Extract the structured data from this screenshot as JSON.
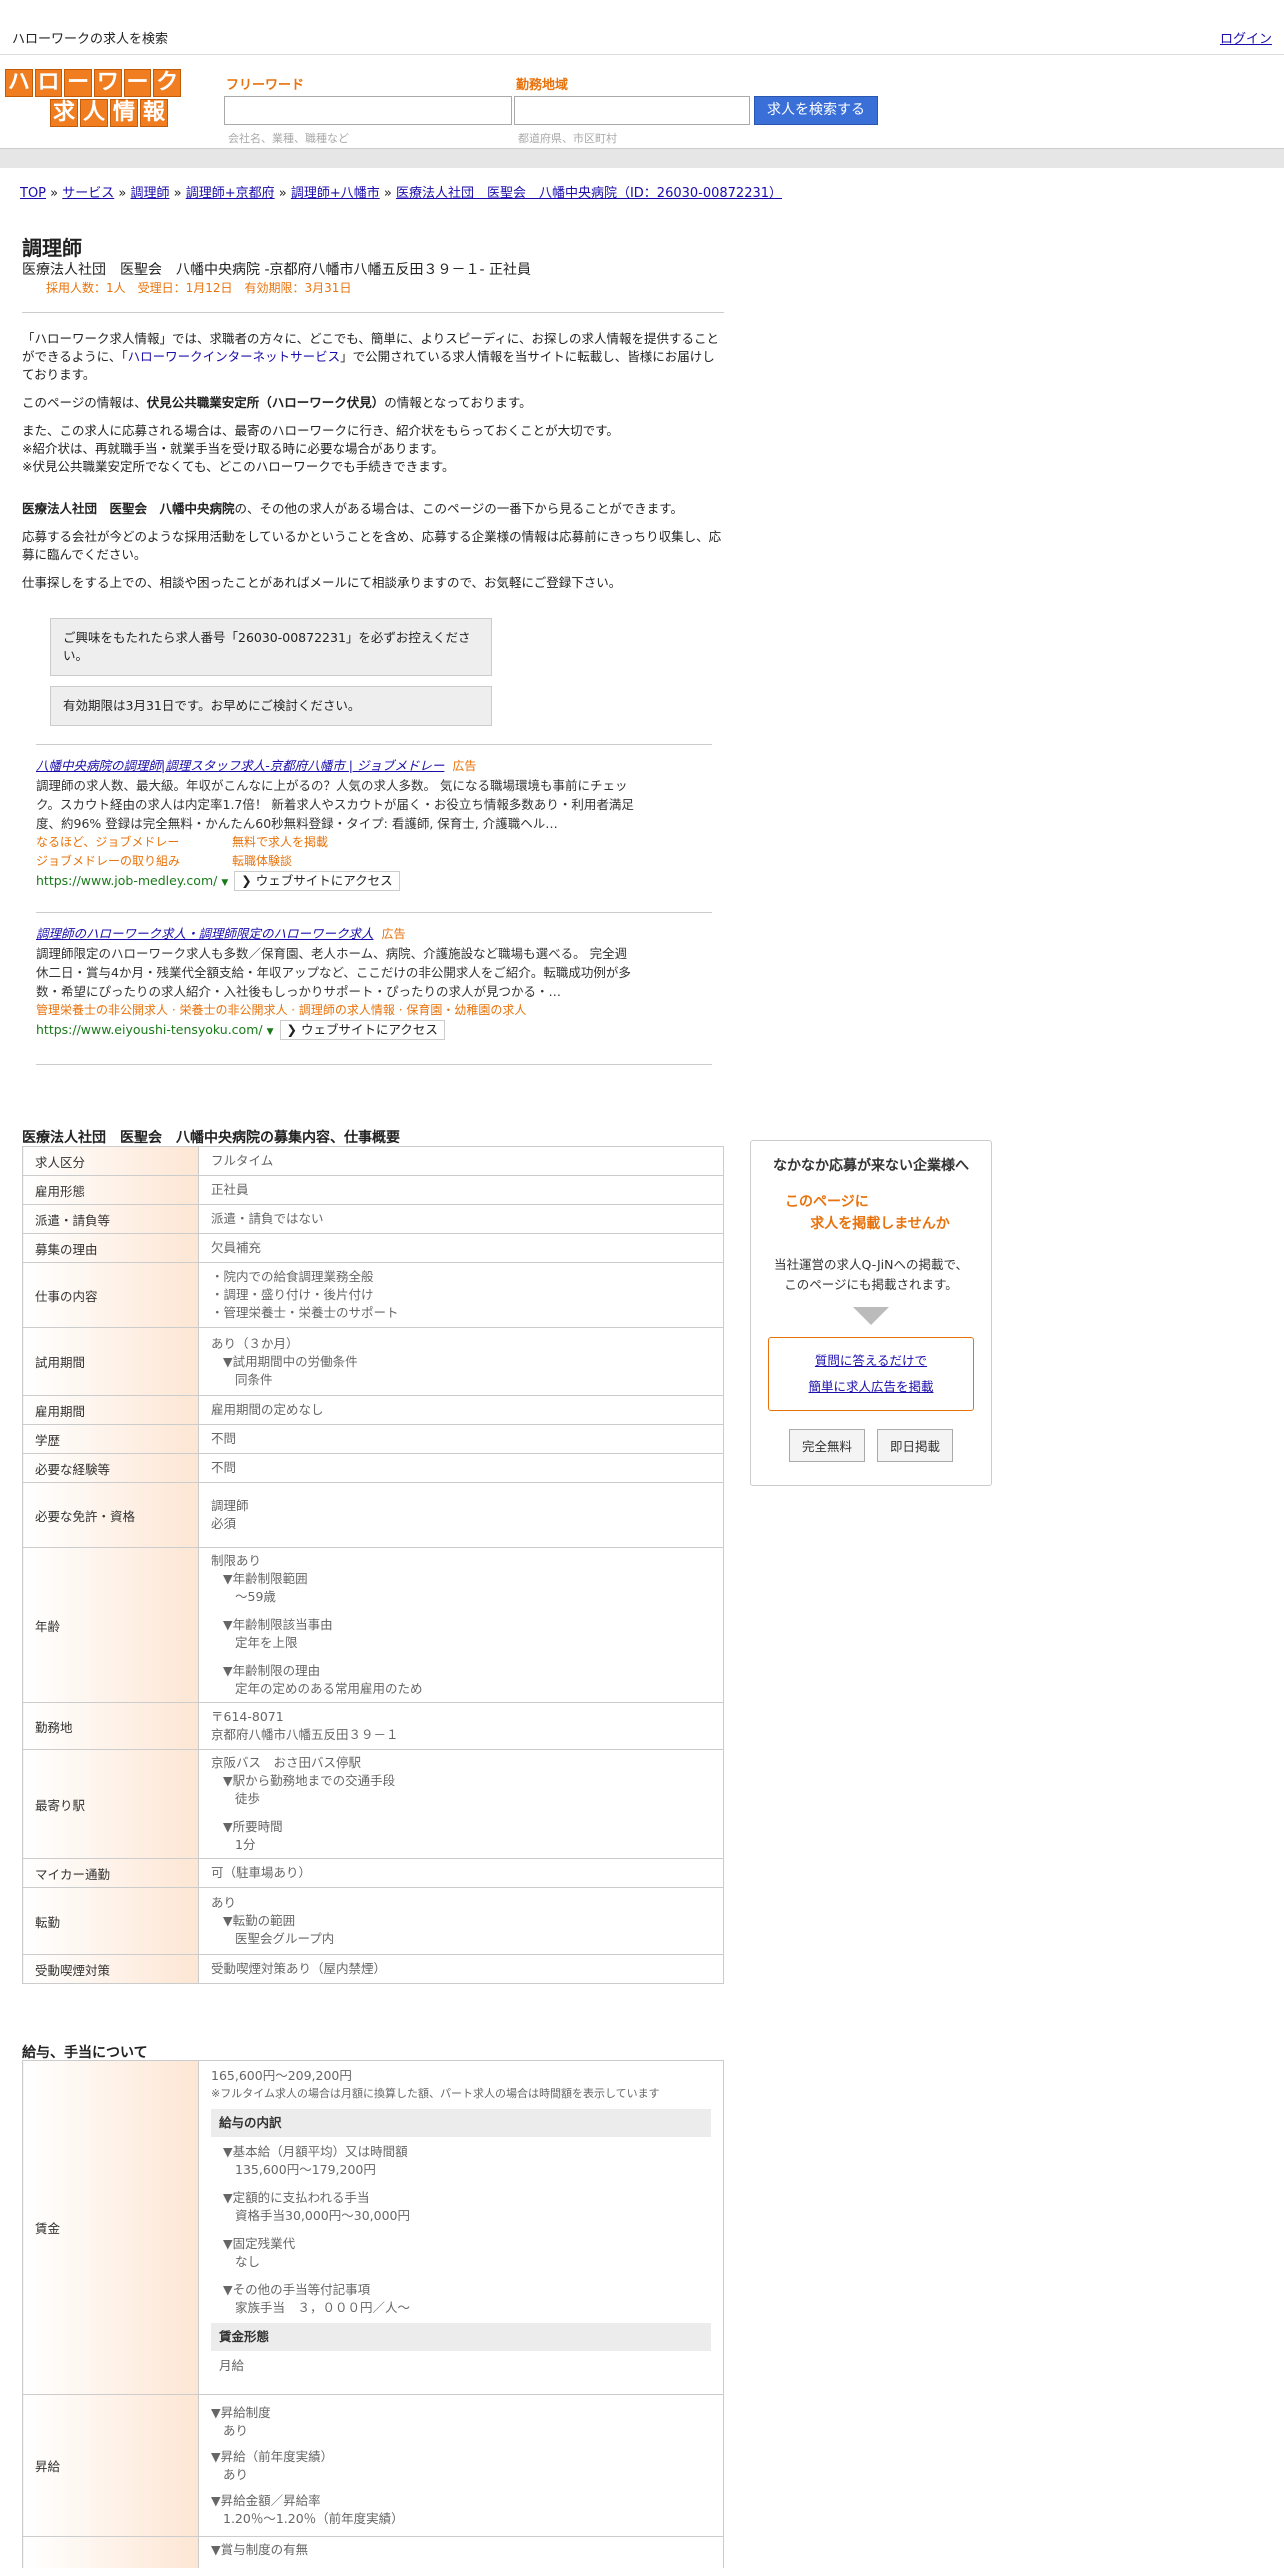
{
  "header": {
    "site_title": "ハローワークの求人を検索",
    "login": "ログイン"
  },
  "logo": {
    "row1": [
      "ハ",
      "ロ",
      "ー",
      "ワ",
      "ー",
      "ク"
    ],
    "row2": [
      "求",
      "人",
      "情",
      "報"
    ]
  },
  "search": {
    "keyword_label": "フリーワード",
    "keyword_hint": "会社名、業種、職種など",
    "area_label": "勤務地域",
    "area_hint": "都道府県、市区町村",
    "button": "求人を検索する"
  },
  "breadcrumb": {
    "items": [
      "TOP",
      "サービス",
      "調理師",
      "調理師+京都府",
      "調理師+八幡市",
      "医療法人社団　医聖会　八幡中央病院（ID：26030-00872231）"
    ],
    "sep": " » "
  },
  "job": {
    "title": "調理師",
    "employer": "医療法人社団　医聖会　八幡中央病院 -京都府八幡市八幡五反田３９－１- 正社員",
    "meta": "採用人数：1人　受理日：1月12日　有効期限：3月31日"
  },
  "intro": {
    "p1_before": "「ハローワーク求人情報」では、求職者の方々に、どこでも、簡単に、よりスピーディに、お探しの求人情報を提供することができるように、「",
    "p1_link": "ハローワークインターネットサービス",
    "p1_after": "」で公開されている求人情報を当サイトに転載し、皆様にお届けしております。",
    "p2_before": "このページの情報は、",
    "p2_bold": "伏見公共職業安定所（ハローワーク伏見）",
    "p2_after": "の情報となっております。",
    "p3_l1": "また、この求人に応募される場合は、最寄のハローワークに行き、紹介状をもらっておくことが大切です。",
    "p3_l2": "※紹介状は、再就職手当・就業手当を受け取る時に必要な場合があります。",
    "p3_l3": "※伏見公共職業安定所でなくても、どこのハローワークでも手続きできます。",
    "p4_bold": "医療法人社団　医聖会　八幡中央病院",
    "p4_after": "の、その他の求人がある場合は、このページの一番下から見ることができます。",
    "p5": "応募する会社が今どのような採用活動をしているかということを含め、応募する企業様の情報は応募前にきっちり収集し、応募に臨んでください。",
    "p6": "仕事探しをする上での、相談や困ったことがあればメールにて相談承りますので、お気軽にご登録下さい。"
  },
  "notices": {
    "n1": "ご興味をもたれたら求人番号「26030-00872231」を必ずお控えください。",
    "n2": "有効期限は3月31日です。お早めにご検討ください。"
  },
  "ads": [
    {
      "title": "八幡中央病院の調理師|調理スタッフ求人-京都府八幡市 | ジョブメドレー",
      "tag": "広告",
      "desc": "調理師の求人数、最大級。年収がこんなに上がるの？人気の求人多数。 気になる職場環境も事前にチェック。スカウト経由の求人は内定率1.7倍！ 新着求人やスカウトが届く・お役立ち情報多数あり・利用者満足度、約96% 登録は完全無料・かんたん60秒無料登録・タイプ: 看護師, 保育士, 介護職ヘル…",
      "links": [
        [
          "なるほど、ジョブメドレー",
          "無料で求人を掲載"
        ],
        [
          "ジョブメドレーの取り組み",
          "転職体験談"
        ]
      ],
      "url": "https://www.job-medley.com/",
      "visit": "ウェブサイトにアクセス"
    },
    {
      "title": "調理師のハローワーク求人・調理師限定のハローワーク求人",
      "tag": "広告",
      "desc": "調理師限定のハローワーク求人も多数／保育園、老人ホーム、病院、介護施設など職場も選べる。 完全週休二日・賞与4か月・残業代全額支給・年収アップなど、ここだけの非公開求人をご紹介。転職成功例が多数・希望にぴったりの求人紹介・入社後もしっかりサポート・ぴったりの求人が見つかる・…",
      "links": [
        [
          "管理栄養士の非公開求人 · 栄養士の非公開求人 · 調理師の求人情報 · 保育園・幼稚園の求人",
          ""
        ]
      ],
      "url": "https://www.eiyoushi-tensyoku.com/",
      "visit": "ウェブサイトにアクセス"
    }
  ],
  "recruit_section": {
    "heading": "医療法人社団　医聖会　八幡中央病院の募集内容、仕事概要",
    "rows": [
      {
        "label": "求人区分",
        "lines": [
          "フルタイム"
        ]
      },
      {
        "label": "雇用形態",
        "lines": [
          "正社員"
        ]
      },
      {
        "label": "派遣・請負等",
        "lines": [
          "派遣・請負ではない"
        ]
      },
      {
        "label": "募集の理由",
        "lines": [
          "欠員補充"
        ]
      },
      {
        "label": "仕事の内容",
        "lines": [
          "・院内での給食調理業務全般",
          "・調理・盛り付け・後片付け",
          "・管理栄養士・栄養士のサポート"
        ]
      },
      {
        "label": "試用期間",
        "lines": [
          "あり（３か月）",
          "▼試用期間中の労働条件",
          "同条件"
        ]
      },
      {
        "label": "雇用期間",
        "lines": [
          "雇用期間の定めなし"
        ]
      },
      {
        "label": "学歴",
        "lines": [
          "不問"
        ]
      },
      {
        "label": "必要な経験等",
        "lines": [
          "不問"
        ]
      },
      {
        "label": "必要な免許・資格",
        "lines": [
          "調理師",
          "必須"
        ]
      },
      {
        "label": "年齢",
        "lines": [
          "制限あり",
          "▼年齢制限範囲",
          "〜59歳",
          "▼年齢制限該当事由",
          "定年を上限",
          "▼年齢制限の理由",
          "定年の定めのある常用雇用のため"
        ]
      },
      {
        "label": "勤務地",
        "lines": [
          "〒614-8071",
          "京都府八幡市八幡五反田３９－１"
        ]
      },
      {
        "label": "最寄り駅",
        "lines": [
          "京阪バス　おさ田バス停駅",
          "▼駅から勤務地までの交通手段",
          "徒歩",
          "▼所要時間",
          "1分"
        ]
      },
      {
        "label": "マイカー通勤",
        "lines": [
          "可（駐車場あり）"
        ]
      },
      {
        "label": "転勤",
        "lines": [
          "あり",
          "▼転勤の範囲",
          "医聖会グループ内"
        ]
      },
      {
        "label": "受動喫煙対策",
        "lines": [
          "受動喫煙対策あり（屋内禁煙）"
        ]
      }
    ]
  },
  "salary_section": {
    "heading": "給与、手当について",
    "wage_label": "賃金",
    "wage_range": "165,600円〜209,200円",
    "wage_note": "※フルタイム求人の場合は月額に換算した額、パート求人の場合は時間額を表示しています",
    "breakdown_head": "給与の内訳",
    "b1_head": "▼基本給（月額平均）又は時間額",
    "b1_val": "135,600円〜179,200円",
    "b2_head": "▼定額的に支払われる手当",
    "b2_val": "資格手当30,000円〜30,000円",
    "b3_head": "▼固定残業代",
    "b3_val": "なし",
    "b4_head": "▼その他の手当等付記事項",
    "b4_val": "家族手当　３，０００円／人～",
    "form_head": "賃金形態",
    "form_val": "月給",
    "raise_label": "昇給",
    "r1_head": "▼昇給制度",
    "r1_val": "あり",
    "r2_head": "▼昇給（前年度実績）",
    "r2_val": "あり",
    "r3_head": "▼昇給金額／昇給率",
    "r3_val": "1.20％〜1.20％（前年度実績）",
    "bonus_head": "▼賞与制度の有無"
  },
  "promo": {
    "title": "なかなか応募が来ない企業様へ",
    "catch1": "このページに",
    "catch2": "求人を掲載しませんか",
    "body1": "当社運営の求人Q-JiNへの掲載で、",
    "body2": "このページにも掲載されます。",
    "link1": "質問に答えるだけで",
    "link2": "簡単に求人広告を掲載",
    "btn1": "完全無料",
    "btn2": "即日掲載"
  }
}
